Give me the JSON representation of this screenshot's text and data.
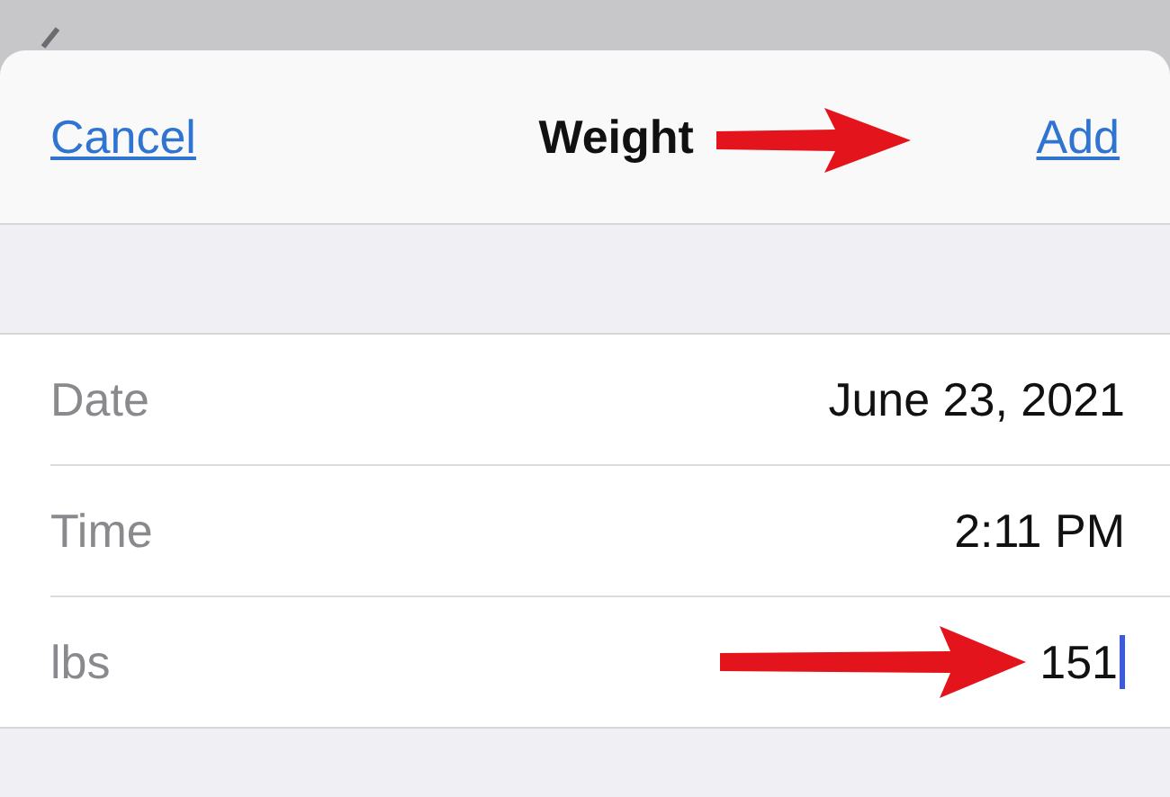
{
  "sheet": {
    "cancel": "Cancel",
    "title": "Weight",
    "add": "Add"
  },
  "rows": [
    {
      "kind": "static",
      "label": "Date",
      "value": "June 23, 2021"
    },
    {
      "kind": "static",
      "label": "Time",
      "value": "2:11 PM"
    },
    {
      "kind": "input",
      "label": "lbs",
      "value": "151",
      "focused": true
    }
  ]
}
